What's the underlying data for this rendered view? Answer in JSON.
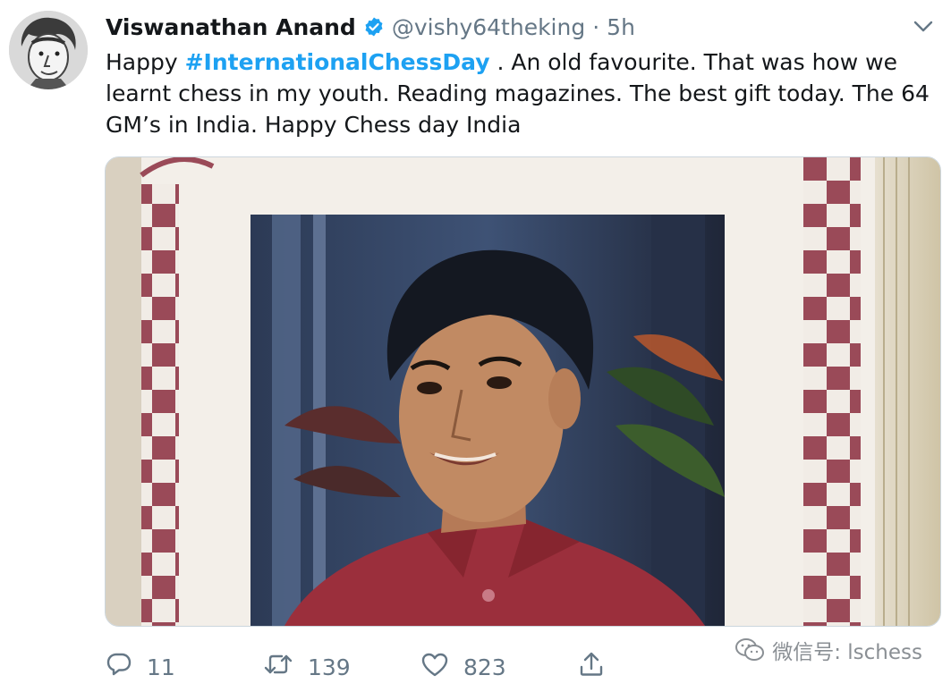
{
  "tweet": {
    "author_name": "Viswanathan Anand",
    "author_handle": "@vishy64theking",
    "separator": "·",
    "time": "5h",
    "text_before": "Happy ",
    "hashtag": "#InternationalChessDay",
    "text_after": " . An old favourite. That was how we learnt chess in my youth. Reading magazines. The best gift today. The 64 GM’s in India. Happy Chess day India"
  },
  "actions": {
    "reply_count": "11",
    "retweet_count": "139",
    "like_count": "823"
  },
  "watermark": {
    "text": "微信号: lschess"
  },
  "colors": {
    "link": "#1da1f2",
    "muted": "#657786",
    "text": "#14171a",
    "verified": "#1da1f2"
  },
  "icons": [
    "avatar-caricature",
    "verified-badge-icon",
    "chevron-down-icon",
    "reply-icon",
    "retweet-icon",
    "like-icon",
    "share-icon",
    "wechat-icon"
  ]
}
